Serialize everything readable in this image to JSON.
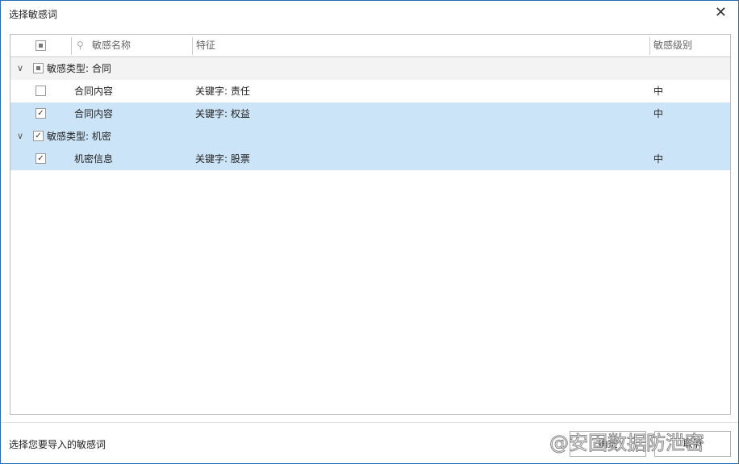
{
  "window": {
    "title": "选择敏感词",
    "close_icon": "close-icon"
  },
  "header": {
    "search_placeholder": "敏感名称",
    "feature": "特征",
    "level": "敏感级别"
  },
  "groups": [
    {
      "label": "敏感类型: 合同",
      "state": "partial",
      "items": [
        {
          "name": "合同内容",
          "feature": "关键字: 责任",
          "level": "中",
          "checked": false
        },
        {
          "name": "合同内容",
          "feature": "关键字: 权益",
          "level": "中",
          "checked": true
        }
      ]
    },
    {
      "label": "敏感类型: 机密",
      "state": "checked",
      "items": [
        {
          "name": "机密信息",
          "feature": "关键字: 股票",
          "level": "中",
          "checked": true
        }
      ]
    }
  ],
  "footer": {
    "status": "选择您要导入的敏感词",
    "ok": "确定",
    "cancel": "取消"
  },
  "watermark": "@安固数据防泄密"
}
